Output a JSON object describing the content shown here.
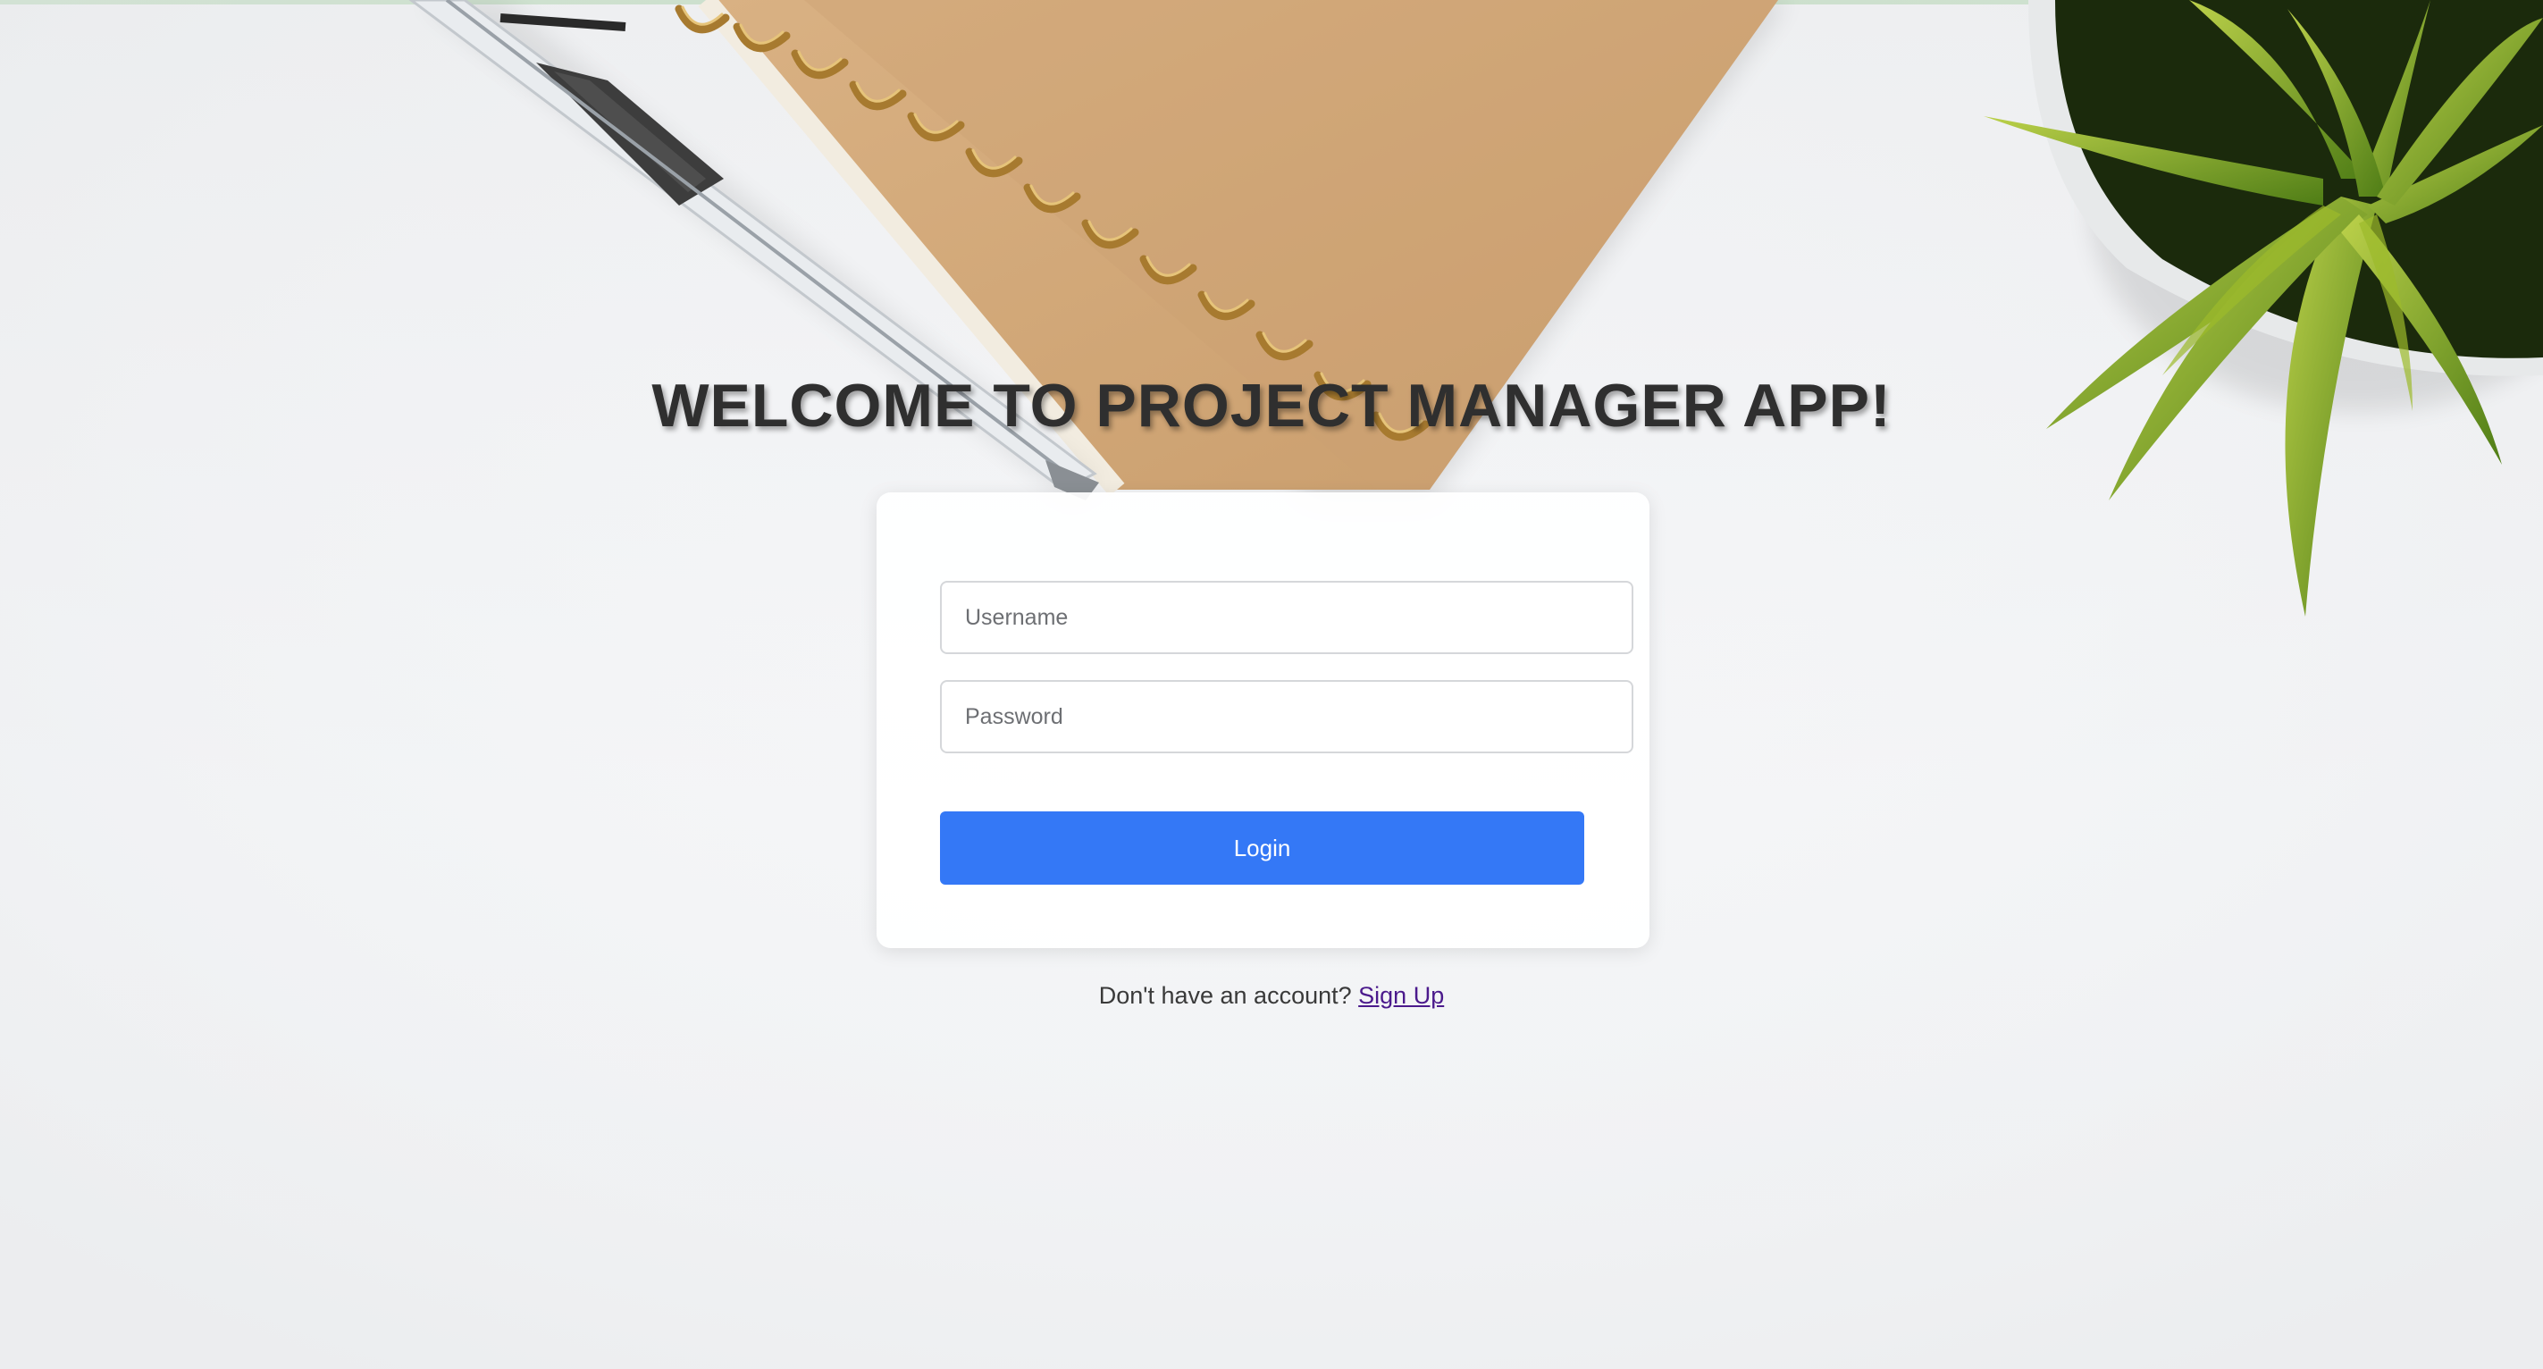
{
  "header": {
    "title": "WELCOME TO PROJECT MANAGER APP!"
  },
  "login_form": {
    "username_placeholder": "Username",
    "username_value": "",
    "password_placeholder": "Password",
    "password_value": "",
    "login_label": "Login"
  },
  "signup": {
    "prompt": "Don't have an account?",
    "link_label": "Sign Up"
  },
  "colors": {
    "accent": "#3478f6",
    "link": "#4b1a8c",
    "heading": "#2f2f2f",
    "background": "#f1f2f4"
  },
  "decor": {
    "notebook_icon": "spiral-notebook-icon",
    "pen_icon": "pen-icon",
    "plant_icon": "potted-plant-icon"
  }
}
